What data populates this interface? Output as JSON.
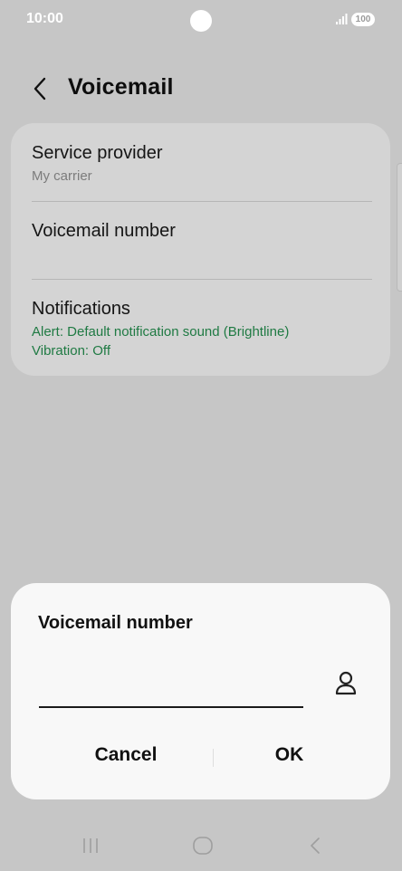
{
  "status_bar": {
    "time": "10:00",
    "battery": "100"
  },
  "header": {
    "title": "Voicemail"
  },
  "settings": {
    "items": [
      {
        "title": "Service provider",
        "subtitle": "My carrier"
      },
      {
        "title": "Voicemail number"
      },
      {
        "title": "Notifications",
        "lines": [
          "Alert: Default notification sound (Brightline)",
          "Vibration: Off"
        ]
      }
    ]
  },
  "dialog": {
    "title": "Voicemail number",
    "input_value": "",
    "cancel_label": "Cancel",
    "ok_label": "OK"
  },
  "nav": {
    "buttons": [
      "recent-apps-icon",
      "home-icon",
      "back-icon"
    ]
  },
  "colors": {
    "background": "#c6c6c6",
    "card": "#d4d4d4",
    "dialog": "#f8f8f8",
    "accent_green": "#1f7a43"
  }
}
